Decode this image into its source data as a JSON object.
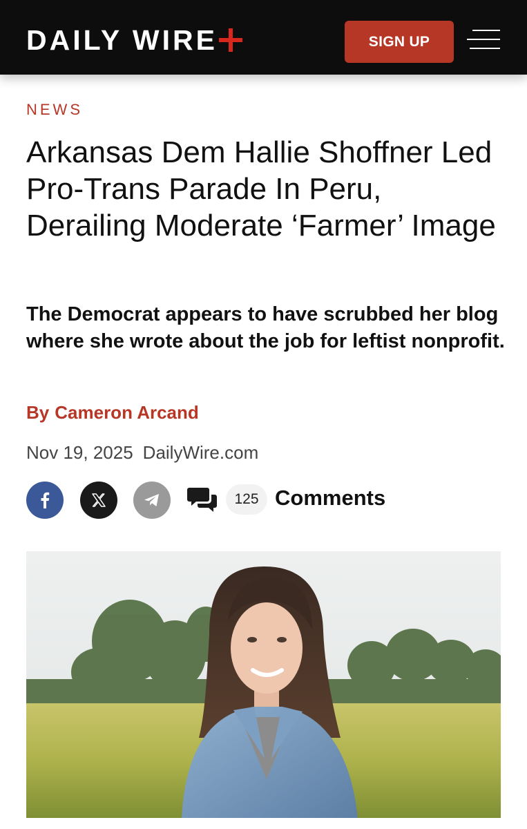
{
  "header": {
    "logo_text": "DAILY WIRE",
    "signup_label": "SIGN UP",
    "brand_red": "#d8281e",
    "menu_icon": "hamburger-icon"
  },
  "article": {
    "category": "NEWS",
    "headline": "Arkansas Dem Hallie Shoffner Led Pro-Trans Parade In Peru, Derailing Moderate ‘Farmer’ Image",
    "subheadline": "The Democrat appears to have scrubbed her blog where she wrote about the job for leftist nonprofit.",
    "byline_prefix": "By",
    "author": "Cameron Arcand",
    "date": "Nov 19, 2025",
    "source": "DailyWire.com",
    "accent_color": "#b73727"
  },
  "share": {
    "facebook_icon": "facebook-icon",
    "x_icon": "x-icon",
    "telegram_icon": "telegram-icon",
    "comments_icon": "comments-icon",
    "comment_count": "125",
    "comments_label": "Comments"
  }
}
